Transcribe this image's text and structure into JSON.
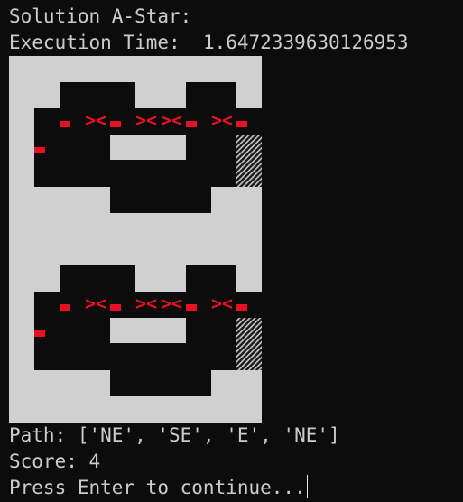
{
  "console": {
    "solution_line": "Solution A-Star:",
    "time_label": "Execution Time:",
    "time_value": "1.6472339630126953",
    "path_line": "Path: ['NE', 'SE', 'E', 'NE']",
    "score_line": "Score: 4",
    "prompt_line": "Press Enter to continue..."
  },
  "maze_glyph": "><",
  "colors": {
    "background": "#0c0c0c",
    "text": "#cccccc",
    "wall": "#d0d0d0",
    "path": "#e81123"
  }
}
